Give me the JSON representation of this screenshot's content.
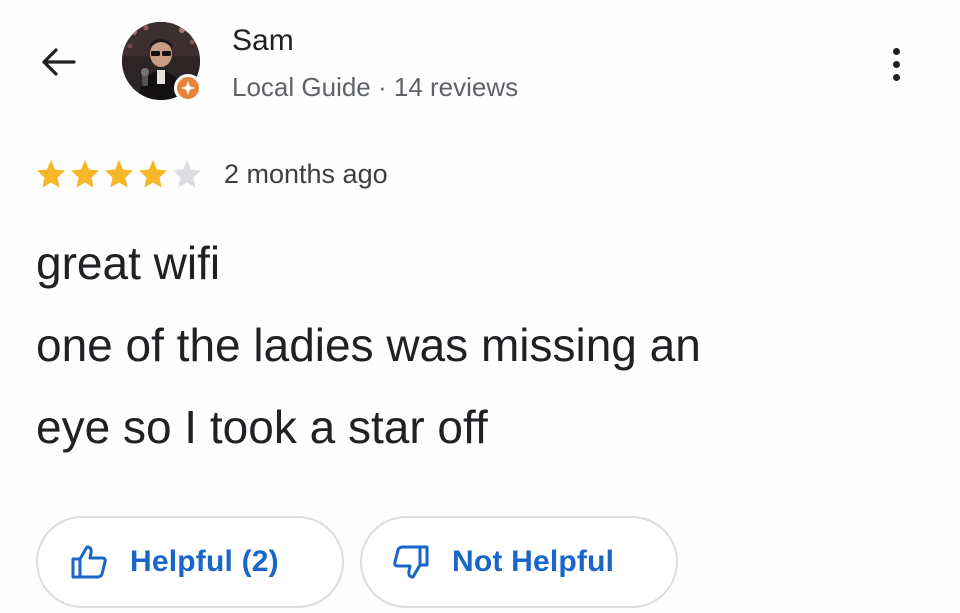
{
  "reviewer": {
    "name": "Sam",
    "meta": "Local Guide · 14 reviews"
  },
  "review": {
    "rating": 4,
    "max_rating": 5,
    "date": "2 months ago",
    "lines": [
      "great wifi",
      "one of the ladies was missing an",
      "eye so I took a star off"
    ]
  },
  "actions": {
    "helpful_label": "Helpful (2)",
    "not_helpful_label": "Not Helpful"
  },
  "colors": {
    "star_filled": "#f6b628",
    "star_empty": "#dadce0",
    "action_text": "#1a65c8",
    "badge": "#e8833a"
  },
  "icons": {
    "back": "arrow-left-icon",
    "more": "more-vert-icon",
    "badge": "local-guide-badge-icon",
    "helpful": "thumb-up-icon",
    "not_helpful": "thumb-down-icon"
  }
}
